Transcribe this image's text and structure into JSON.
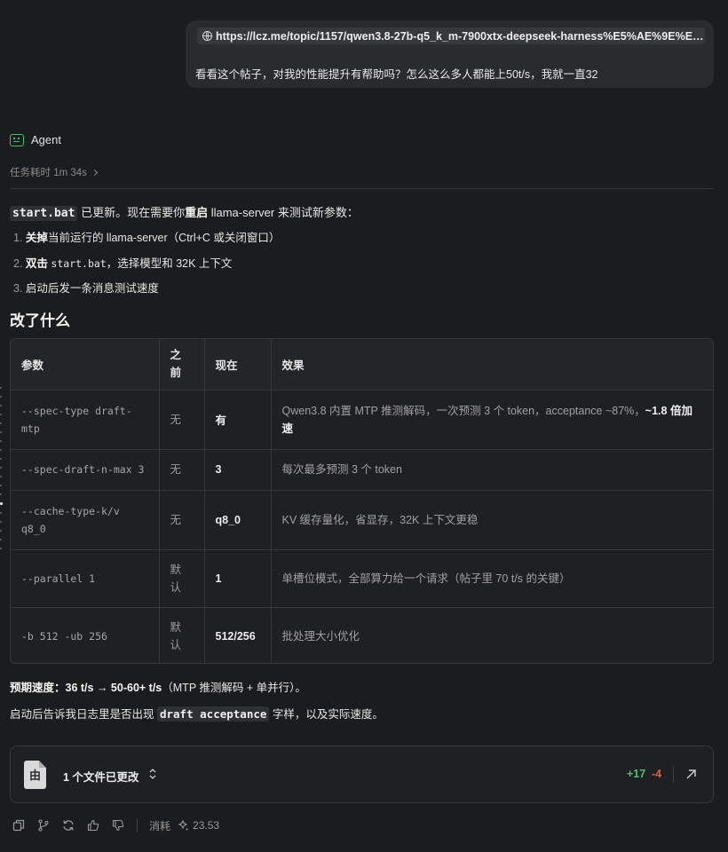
{
  "user_message": {
    "url": "https://lcz.me/topic/1157/qwen3.8-27b-q5_k_m-7900xtx-deepseek-harness%E5%AE%9E%E6%...",
    "text": "看看这个帖子，对我的性能提升有帮助吗？怎么这么多人都能上50t/s，我就一直32"
  },
  "agent": {
    "name": "Agent",
    "duration": "任务耗时 1m 34s",
    "intro": {
      "code": "start.bat",
      "text1": " 已更新。现在需要你",
      "bold": "重启",
      "text2": " llama-server 来测试新参数："
    },
    "steps": [
      {
        "num": "1.",
        "bold": "关掉",
        "text": "当前运行的 llama-server（Ctrl+C 或关闭窗口）"
      },
      {
        "num": "2.",
        "bold": "双击",
        "code": "start.bat",
        "text": "，选择模型和 32K 上下文"
      },
      {
        "num": "3.",
        "text": "启动后发一条消息测试速度"
      }
    ],
    "section_title": "改了什么",
    "table": {
      "headers": [
        "参数",
        "之前",
        "现在",
        "效果"
      ],
      "rows": [
        {
          "param": "--spec-type draft-mtp",
          "before": "无",
          "now": "有",
          "effect": "Qwen3.8 内置 MTP 推测解码，一次预测 3 个 token，acceptance ~87%，",
          "effect_bold": "~1.8 倍加速"
        },
        {
          "param": "--spec-draft-n-max 3",
          "before": "无",
          "now": "3",
          "effect": "每次最多预测 3 个 token",
          "effect_bold": ""
        },
        {
          "param": "--cache-type-k/v q8_0",
          "before": "无",
          "now": "q8_0",
          "effect": "KV 缓存量化，省显存，32K 上下文更稳",
          "effect_bold": ""
        },
        {
          "param": "--parallel 1",
          "before": "默认",
          "now": "1",
          "effect": "单槽位模式，全部算力给一个请求（帖子里 70 t/s 的关键）",
          "effect_bold": ""
        },
        {
          "param": "-b 512 -ub 256",
          "before": "默认",
          "now": "512/256",
          "effect": "批处理大小优化",
          "effect_bold": ""
        }
      ]
    },
    "speed": {
      "label": "预期速度：",
      "value": "36 t/s → 50-60+ t/s",
      "note": "（MTP 推测解码 + 单并行）。"
    },
    "report": {
      "text1": "启动后告诉我日志里是否出现 ",
      "code": "draft acceptance",
      "text2": " 字样，以及实际速度。"
    }
  },
  "file_changes": {
    "label": "1 个文件已更改",
    "additions": "+17",
    "deletions": "-4",
    "icon_glyph": "由"
  },
  "footer": {
    "consume_label": "消耗",
    "tokens": "23.53"
  },
  "colors": {
    "background": "#1b1c1e",
    "additions": "#4fbf73",
    "deletions": "#e25a4f",
    "agent_icon": "#39c16a"
  }
}
